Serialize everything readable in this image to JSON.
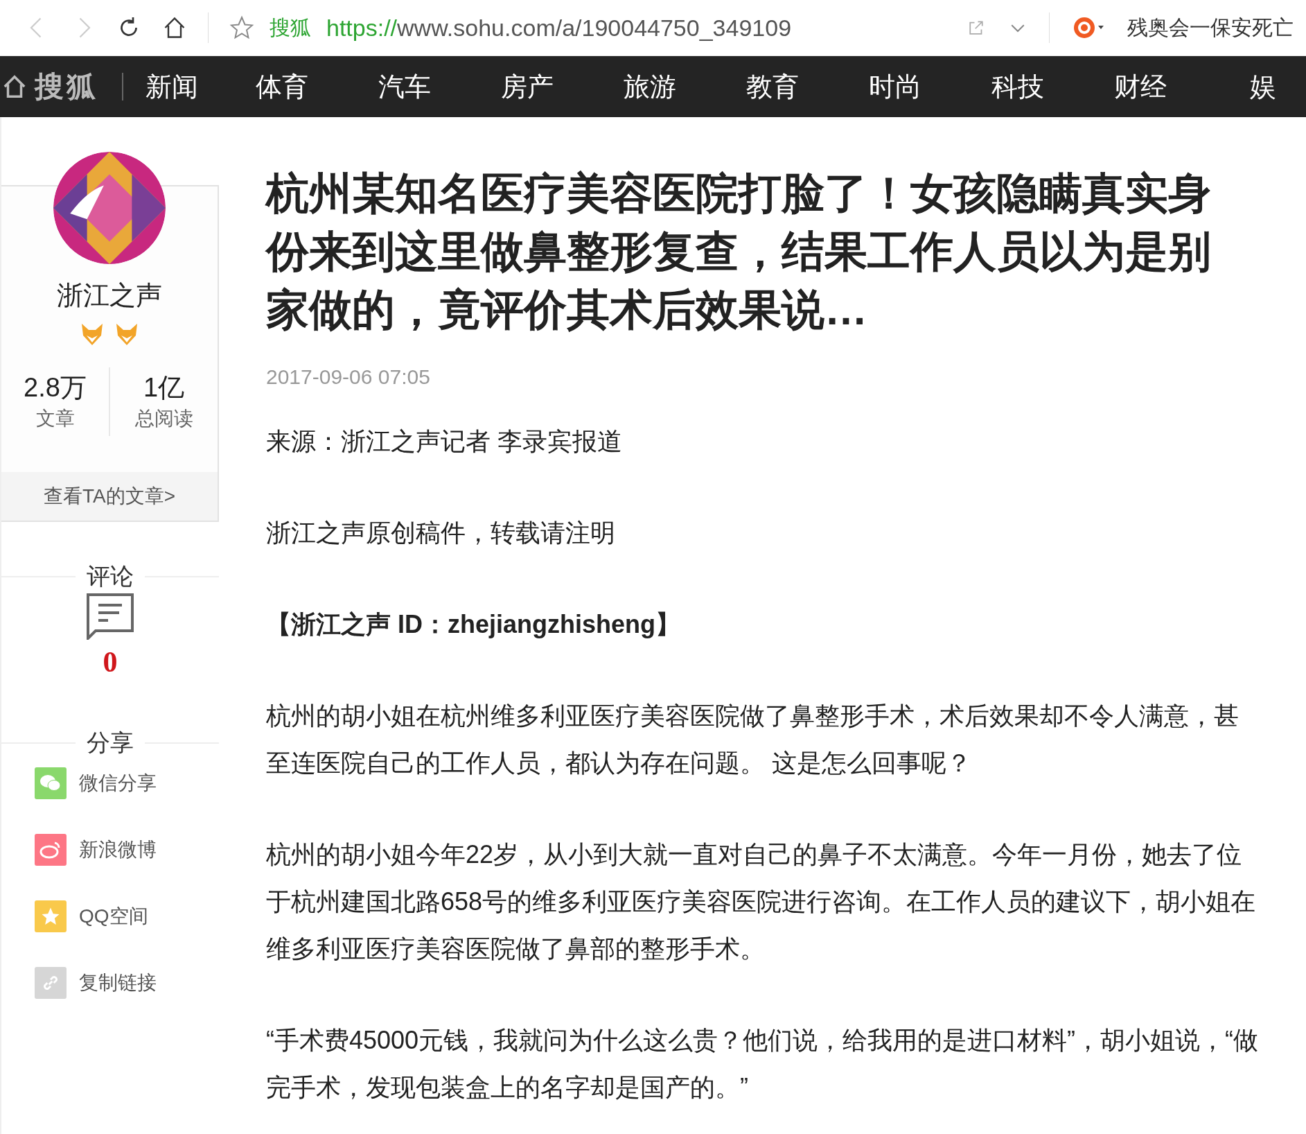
{
  "browser": {
    "site_label": "搜狐",
    "url_scheme": "https://",
    "url_rest": "www.sohu.com/a/190044750_349109",
    "hot_search": "残奥会一保安死亡"
  },
  "nav": {
    "logo": "搜狐",
    "items": [
      "新闻",
      "体育",
      "汽车",
      "房产",
      "旅游",
      "教育",
      "时尚",
      "科技",
      "财经",
      "娱"
    ]
  },
  "author": {
    "name": "浙江之声",
    "badges": [
      {
        "kind": "fox"
      },
      {
        "kind": "fox"
      }
    ],
    "stats": [
      {
        "value": "2.8万",
        "label": "文章"
      },
      {
        "value": "1亿",
        "label": "总阅读"
      }
    ],
    "link": "查看TA的文章>"
  },
  "comments": {
    "heading": "评论",
    "count": "0"
  },
  "share": {
    "heading": "分享",
    "items": [
      {
        "label": "微信分享",
        "kind": "wechat",
        "color": "#8ad86c"
      },
      {
        "label": "新浪微博",
        "kind": "weibo",
        "color": "#fd7685"
      },
      {
        "label": "QQ空间",
        "kind": "qzone",
        "color": "#f9c94b"
      },
      {
        "label": "复制链接",
        "kind": "link",
        "color": "#d6d6d6"
      }
    ]
  },
  "article": {
    "title": "杭州某知名医疗美容医院打脸了！女孩隐瞒真实身份来到这里做鼻整形复查，结果工作人员以为是别家做的，竟评价其术后效果说…",
    "date": "2017-09-06 07:05",
    "paragraphs": [
      {
        "kind": "text",
        "text": "来源：浙江之声记者 李录宾报道"
      },
      {
        "kind": "text",
        "text": "浙江之声原创稿件，转载请注明"
      },
      {
        "kind": "bold",
        "text": "【浙江之声 ID：zhejiangzhisheng】"
      },
      {
        "kind": "text",
        "text": "杭州的胡小姐在杭州维多利亚医疗美容医院做了鼻整形手术，术后效果却不令人满意，甚至连医院自己的工作人员，都认为存在问题。 这是怎么回事呢？"
      },
      {
        "kind": "text",
        "text": "杭州的胡小姐今年22岁，从小到大就一直对自己的鼻子不太满意。今年一月份，她去了位于杭州建国北路658号的维多利亚医疗美容医院进行咨询。在工作人员的建议下，胡小姐在维多利亚医疗美容医院做了鼻部的整形手术。"
      },
      {
        "kind": "text",
        "text": "“手术费45000元钱，我就问为什么这么贵？他们说，给我用的是进口材料”，胡小姐说，“做完手术，发现包装盒上的名字却是国产的。”"
      }
    ]
  }
}
